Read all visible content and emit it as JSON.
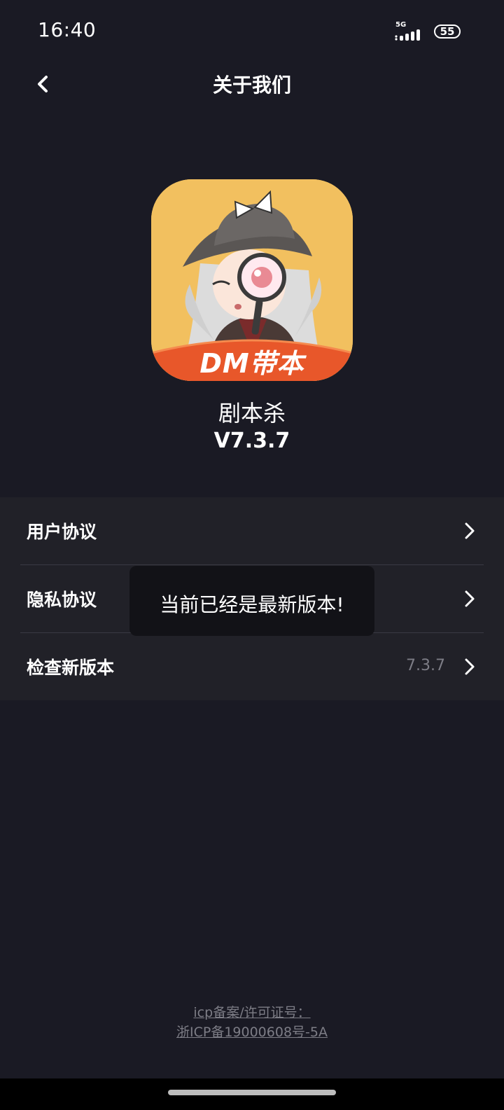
{
  "status_bar": {
    "time": "16:40",
    "network": "5G",
    "battery": "55"
  },
  "header": {
    "title": "关于我们",
    "back_icon": "chevron-left-icon"
  },
  "app": {
    "icon_badge_text": "DM带本",
    "name": "剧本杀",
    "version": "V7.3.7",
    "icon_bg_color": "#f2c05f",
    "badge_color": "#e8572a"
  },
  "menu": {
    "items": [
      {
        "label": "用户协议",
        "value": ""
      },
      {
        "label": "隐私协议",
        "value": ""
      },
      {
        "label": "检查新版本",
        "value": "7.3.7"
      }
    ],
    "chevron_icon": "chevron-right-icon"
  },
  "toast": {
    "text": "当前已经是最新版本!"
  },
  "footer": {
    "line1": "icp备案/许可证号：",
    "line2": "浙ICP备19000608号-5A"
  },
  "colors": {
    "background": "#1a1a24",
    "menu_background": "#212128",
    "secondary_text": "#7d7d86"
  }
}
